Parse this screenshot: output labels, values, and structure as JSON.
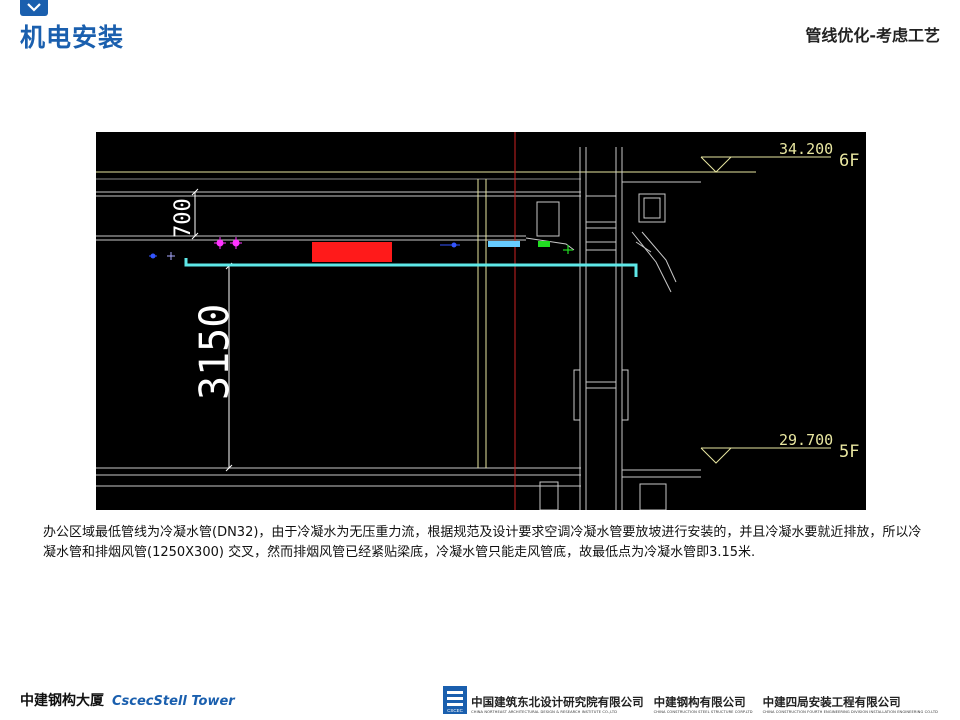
{
  "header": {
    "title": "机电安装",
    "subtitle": "管线优化-考虑工艺"
  },
  "drawing": {
    "floor_upper": {
      "elevation": "34.200",
      "label": "6F"
    },
    "floor_lower": {
      "elevation": "29.700",
      "label": "5F"
    },
    "dim_upper": "700",
    "dim_lower": "3150",
    "colors": {
      "background": "#000000",
      "structure": "#c8c8c8",
      "yellow": "#e8e6a0",
      "grid_axis": "#cc2222",
      "duct": "#ff1a1a",
      "condensate_pipe": "#5ee8e8",
      "cyan_block": "#66ccff",
      "green_block": "#22dd22"
    }
  },
  "caption": "办公区域最低管线为冷凝水管(DN32)，由于冷凝水为无压重力流，根据规范及设计要求空调冷凝水管要放坡进行安装的，并且冷凝水要就近排放，所以冷凝水管和排烟风管(1250X300) 交叉，然而排烟风管已经紧贴梁底，冷凝水管只能走风管底，故最低点为冷凝水管即3.15米.",
  "footer": {
    "project_cn": "中建钢构大厦",
    "project_en": "CscecStell Tower",
    "org1_cn": "中国建筑东北设计研究院有限公司",
    "org1_en": "CHINA NORTHEAST ARCHITECTURAL DESIGN & RESEARCH INSTITUTE CO.,LTD",
    "org2_cn": "中建钢构有限公司",
    "org2_en": "CHINA CONSTRUCTION STEEL STRUCTURE CORP.LTD",
    "org3_cn": "中建四局安装工程有限公司",
    "org3_en": "CHINA CONSTRUCTION FOURTH ENGINEERING DIVISION INSTALLATION ENGINEERING CO.LTD",
    "logo_text": "CSCEC"
  }
}
